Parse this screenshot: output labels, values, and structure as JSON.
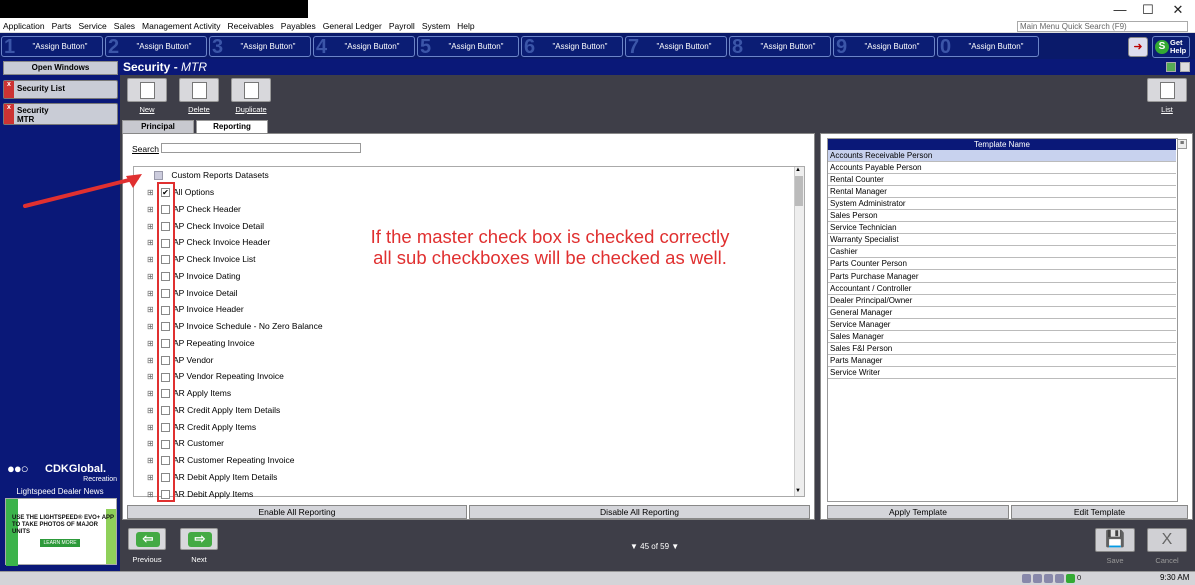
{
  "window": {
    "minimize": "—",
    "maximize": "☐",
    "close": "✕"
  },
  "menu": [
    "Application",
    "Parts",
    "Service",
    "Sales",
    "Management Activity",
    "Receivables",
    "Payables",
    "General Ledger",
    "Payroll",
    "System",
    "Help"
  ],
  "quick_search": "Main Menu Quick Search (F9)",
  "assign_buttons": [
    {
      "num": "1",
      "label": "\"Assign Button\""
    },
    {
      "num": "2",
      "label": "\"Assign Button\""
    },
    {
      "num": "3",
      "label": "\"Assign Button\""
    },
    {
      "num": "4",
      "label": "\"Assign Button\""
    },
    {
      "num": "5",
      "label": "\"Assign Button\""
    },
    {
      "num": "6",
      "label": "\"Assign Button\""
    },
    {
      "num": "7",
      "label": "\"Assign Button\""
    },
    {
      "num": "8",
      "label": "\"Assign Button\""
    },
    {
      "num": "9",
      "label": "\"Assign Button\""
    },
    {
      "num": "0",
      "label": "\"Assign Button\""
    }
  ],
  "get_help": {
    "s": "S",
    "line1": "Get",
    "line2": "Help"
  },
  "left": {
    "open_windows": "Open Windows",
    "windows": [
      {
        "label": "Security List"
      },
      {
        "label": "Security\nMTR"
      }
    ],
    "logo": {
      "dots": "●●○",
      "name": "CDKGlobal.",
      "sub": "Recreation"
    },
    "news": "Lightspeed Dealer News",
    "ad": {
      "text": "USE THE LIGHTSPEED® EVO+ APP\nTO TAKE PHOTOS OF MAJOR UNITS",
      "button": "LEARN MORE"
    }
  },
  "header": {
    "title": "Security - ",
    "title_italic": "MTR"
  },
  "toolbar": {
    "new": "New",
    "delete": "Delete",
    "duplicate": "Duplicate",
    "list": "List"
  },
  "tabs": [
    "Principal",
    "Reporting"
  ],
  "search_label": "Search",
  "tree": {
    "root": "Custom Reports Datasets",
    "items": [
      {
        "label": "All Options",
        "checked": true
      },
      {
        "label": "AP Check Header"
      },
      {
        "label": "AP Check Invoice Detail"
      },
      {
        "label": "AP Check Invoice Header"
      },
      {
        "label": "AP Check Invoice List"
      },
      {
        "label": "AP Invoice Dating"
      },
      {
        "label": "AP Invoice Detail"
      },
      {
        "label": "AP Invoice Header"
      },
      {
        "label": "AP Invoice Schedule - No Zero Balance"
      },
      {
        "label": "AP Repeating Invoice"
      },
      {
        "label": "AP Vendor"
      },
      {
        "label": "AP Vendor Repeating Invoice"
      },
      {
        "label": "AR Apply Items"
      },
      {
        "label": "AR Credit Apply Item Details"
      },
      {
        "label": "AR Credit Apply Items"
      },
      {
        "label": "AR Customer"
      },
      {
        "label": "AR Customer Repeating Invoice"
      },
      {
        "label": "AR Debit Apply Item Details"
      },
      {
        "label": "AR Debit Apply Items"
      }
    ]
  },
  "annotation": "If the master check box is checked correctly\nall sub checkboxes will be checked as well.",
  "buttons": {
    "enable": "Enable All Reporting",
    "disable": "Disable All Reporting",
    "apply": "Apply Template",
    "edit": "Edit Template"
  },
  "template": {
    "header": "Template Name",
    "rows": [
      "Accounts Receivable Person",
      "Accounts Payable Person",
      "Rental Counter",
      "Rental Manager",
      "System Administrator",
      "Sales Person",
      "Service Technician",
      "Warranty Specialist",
      "Cashier",
      "Parts Counter Person",
      "Parts Purchase Manager",
      "Accountant / Controller",
      "Dealer Principal/Owner",
      "General Manager",
      "Service Manager",
      "Sales Manager",
      "Sales F&I Person",
      "Parts Manager",
      "Service Writer"
    ]
  },
  "footer": {
    "previous": "Previous",
    "next": "Next",
    "pager": "▼ 45  of  59 ▼",
    "save": "Save",
    "cancel": "Cancel"
  },
  "tray": {
    "count": "0",
    "time": "9:30 AM"
  }
}
